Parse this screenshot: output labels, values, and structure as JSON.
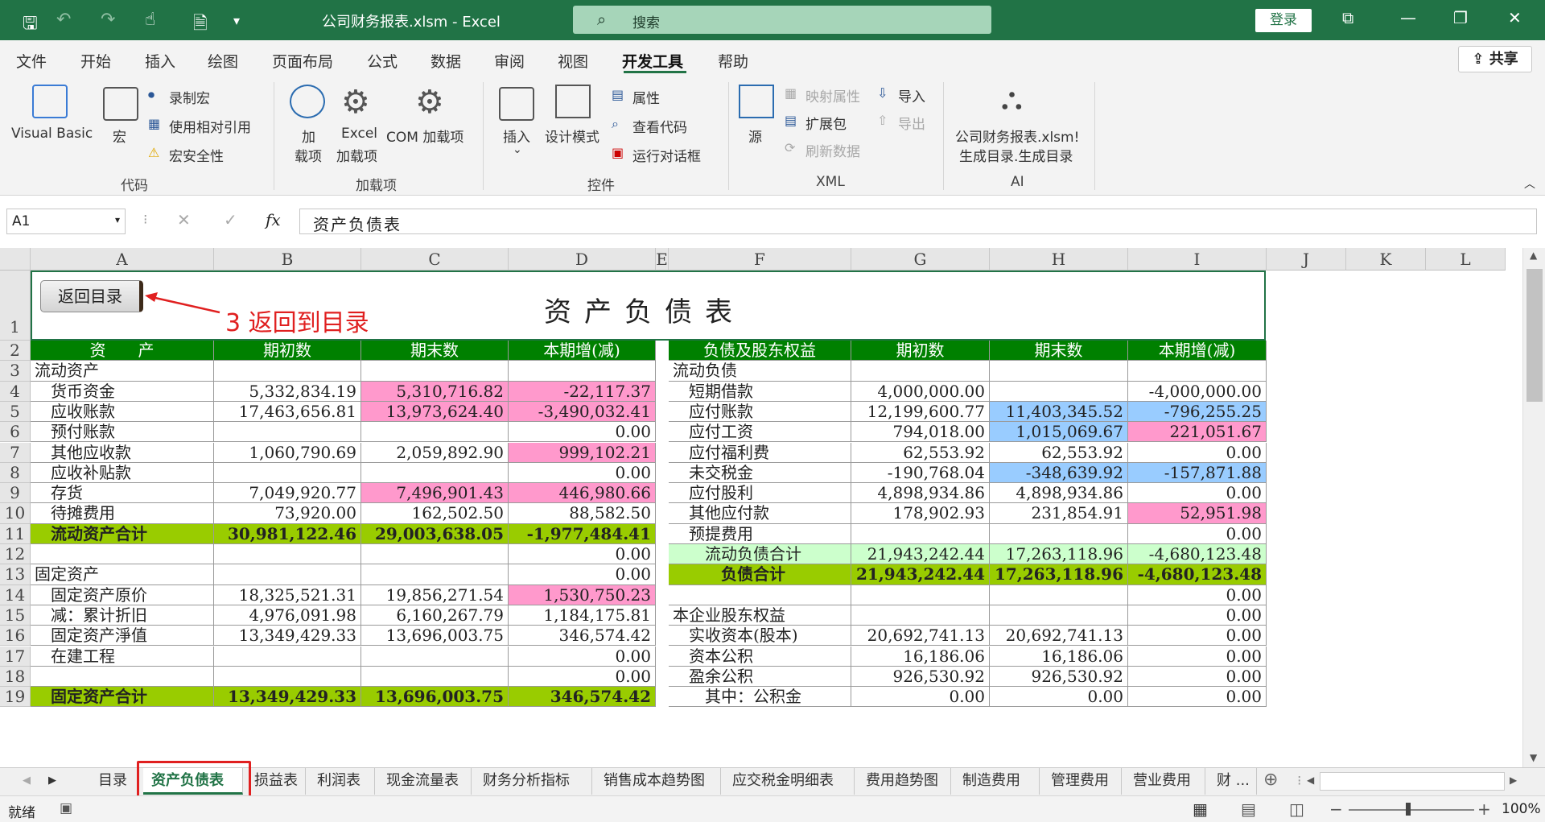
{
  "titlebar": {
    "doc_title": "公司财务报表.xlsm  -  Excel",
    "search_placeholder": "搜索",
    "login": "登录"
  },
  "menu": [
    "文件",
    "开始",
    "插入",
    "绘图",
    "页面布局",
    "公式",
    "数据",
    "审阅",
    "视图",
    "开发工具",
    "帮助"
  ],
  "active_menu": "开发工具",
  "share": "共享",
  "ribbon": {
    "code": {
      "label": "代码",
      "visual_basic": "Visual Basic",
      "macro": "宏",
      "record_macro": "录制宏",
      "use_relative": "使用相对引用",
      "macro_security": "宏安全性"
    },
    "addins": {
      "label": "加载项",
      "add": "加",
      "add2": "载项",
      "excel_addin": "Excel",
      "excel_addin2": "加载项",
      "com_addin": "COM 加载项"
    },
    "controls": {
      "label": "控件",
      "insert": "插入",
      "design_mode": "设计模式",
      "properties": "属性",
      "view_code": "查看代码",
      "run_dialog": "运行对话框"
    },
    "xml": {
      "label": "XML",
      "source": "源",
      "map_props": "映射属性",
      "expansion": "扩展包",
      "refresh": "刷新数据",
      "import": "导入",
      "export": "导出"
    },
    "ai": {
      "label": "AI",
      "line1": "公司财务报表.xlsm!",
      "line2": "生成目录.生成目录"
    }
  },
  "formula": {
    "namebox": "A1",
    "fx": "fx",
    "content": "资产负债表"
  },
  "columns": [
    "A",
    "B",
    "C",
    "D",
    "E",
    "F",
    "G",
    "H",
    "I",
    "J",
    "K",
    "L"
  ],
  "sheet": {
    "return_button": "返回目录",
    "annotation": "3 返回到目录",
    "title": "资产负债表",
    "headers_left": [
      "资　　产",
      "期初数",
      "期末数",
      "本期增(减)"
    ],
    "headers_right": [
      "负债及股东权益",
      "期初数",
      "期末数",
      "本期增(减)"
    ],
    "left_rows": [
      [
        "流动资产",
        "",
        "",
        ""
      ],
      [
        "　货币资金",
        "5,332,834.19",
        "5,310,716.82",
        "-22,117.37"
      ],
      [
        "　应收账款",
        "17,463,656.81",
        "13,973,624.40",
        "-3,490,032.41"
      ],
      [
        "　预付账款",
        "",
        "",
        "0.00"
      ],
      [
        "　其他应收款",
        "1,060,790.69",
        "2,059,892.90",
        "999,102.21"
      ],
      [
        "　应收补贴款",
        "",
        "",
        "0.00"
      ],
      [
        "　存货",
        "7,049,920.77",
        "7,496,901.43",
        "446,980.66"
      ],
      [
        "　待摊费用",
        "73,920.00",
        "162,502.50",
        "88,582.50"
      ],
      [
        "　流动资产合计",
        "30,981,122.46",
        "29,003,638.05",
        "-1,977,484.41"
      ],
      [
        "",
        "",
        "",
        "0.00"
      ],
      [
        "固定资产",
        "",
        "",
        "0.00"
      ],
      [
        "　固定资产原价",
        "18,325,521.31",
        "19,856,271.54",
        "1,530,750.23"
      ],
      [
        "　减：累计折旧",
        "4,976,091.98",
        "6,160,267.79",
        "1,184,175.81"
      ],
      [
        "　固定资产淨值",
        "13,349,429.33",
        "13,696,003.75",
        "346,574.42"
      ],
      [
        "　在建工程",
        "",
        "",
        "0.00"
      ],
      [
        "",
        "",
        "",
        "0.00"
      ],
      [
        "　固定资产合计",
        "13,349,429.33",
        "13,696,003.75",
        "346,574.42"
      ]
    ],
    "right_rows": [
      [
        "流动负债",
        "",
        "",
        ""
      ],
      [
        "　短期借款",
        "4,000,000.00",
        "",
        "-4,000,000.00"
      ],
      [
        "　应付账款",
        "12,199,600.77",
        "11,403,345.52",
        "-796,255.25"
      ],
      [
        "　应付工资",
        "794,018.00",
        "1,015,069.67",
        "221,051.67"
      ],
      [
        "　应付福利费",
        "62,553.92",
        "62,553.92",
        "0.00"
      ],
      [
        "　未交税金",
        "-190,768.04",
        "-348,639.92",
        "-157,871.88"
      ],
      [
        "　应付股利",
        "4,898,934.86",
        "4,898,934.86",
        "0.00"
      ],
      [
        "　其他应付款",
        "178,902.93",
        "231,854.91",
        "52,951.98"
      ],
      [
        "　预提费用",
        "",
        "",
        "0.00"
      ],
      [
        "　　流动负债合计",
        "21,943,242.44",
        "17,263,118.96",
        "-4,680,123.48"
      ],
      [
        "　　　负债合计",
        "21,943,242.44",
        "17,263,118.96",
        "-4,680,123.48"
      ],
      [
        "",
        "",
        "",
        "0.00"
      ],
      [
        "本企业股东权益",
        "",
        "",
        "0.00"
      ],
      [
        "　实收资本(股本)",
        "20,692,741.13",
        "20,692,741.13",
        "0.00"
      ],
      [
        "　资本公积",
        "16,186.06",
        "16,186.06",
        "0.00"
      ],
      [
        "　盈余公积",
        "926,530.92",
        "926,530.92",
        "0.00"
      ],
      [
        "　　其中：公积金",
        "0.00",
        "0.00",
        "0.00"
      ]
    ],
    "row_numbers": [
      "1",
      "2",
      "3",
      "4",
      "5",
      "6",
      "7",
      "8",
      "9",
      "10",
      "11",
      "12",
      "13",
      "14",
      "15",
      "16",
      "17",
      "18",
      "19"
    ]
  },
  "tabs": [
    "目录",
    "资产负债表",
    "损益表",
    "利润表",
    "现金流量表",
    "财务分析指标",
    "销售成本趋势图",
    "应交税金明细表",
    "费用趋势图",
    "制造费用",
    "管理费用",
    "营业费用",
    "财 ..."
  ],
  "active_tab": "资产负债表",
  "status": {
    "ready": "就绪",
    "zoom": "100%"
  },
  "colors": {
    "excel_green": "#217346",
    "header_green": "#008000",
    "pink": "#ff99cc",
    "blue": "#99ccff",
    "light_green": "#ccffcc",
    "yellow_green": "#99cc00",
    "annotation_red": "#e02020"
  }
}
